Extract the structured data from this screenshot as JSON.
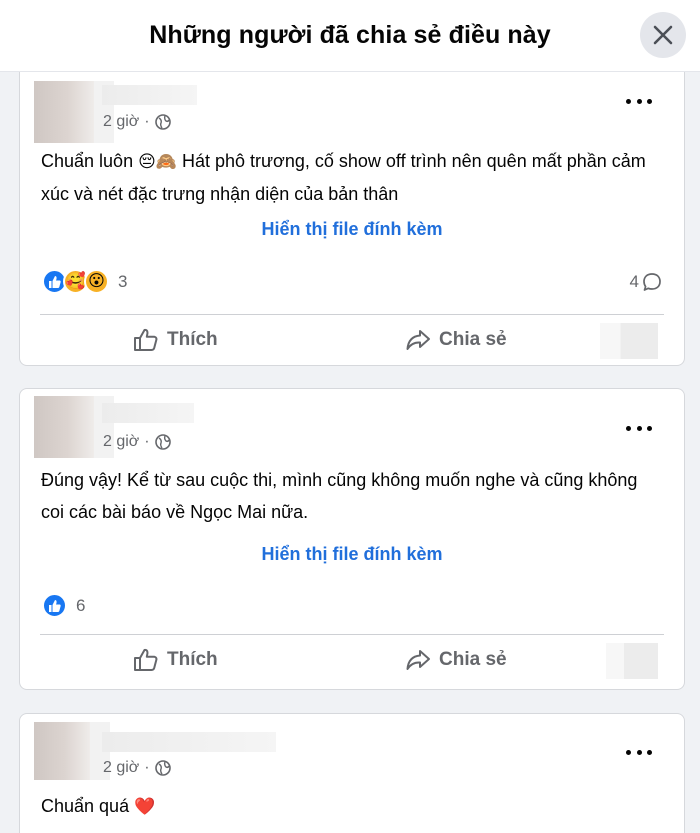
{
  "header": {
    "title": "Những người đã chia sẻ điều này"
  },
  "posts": [
    {
      "time": "2 giờ",
      "text_before_emoji": "Chuẩn luôn ",
      "emojis": "😔🙈",
      "text_after_emoji": " Hát phô trương, cố show off trình nên quên mất phần cảm xúc và nét đặc trưng nhận diện của bản thân",
      "attachment_link": "Hiển thị file đính kèm",
      "reaction_count": "3",
      "comment_count": "4",
      "like_label": "Thích",
      "share_label": "Chia sẻ"
    },
    {
      "time": "2 giờ",
      "text": "Đúng vậy! Kể từ sau cuộc thi, mình cũng không muốn nghe và cũng không coi các bài báo về Ngọc Mai nữa.",
      "attachment_link": "Hiển thị file đính kèm",
      "reaction_count": "6",
      "like_label": "Thích",
      "share_label": "Chia sẻ"
    },
    {
      "time": "2 giờ",
      "text": "Chuẩn quá",
      "emoji": "❤️"
    }
  ],
  "colors": {
    "link_blue": "#216fdb",
    "like_blue": "#1877f2",
    "secondary_text": "#65676b",
    "heart_red": "#f02849"
  }
}
